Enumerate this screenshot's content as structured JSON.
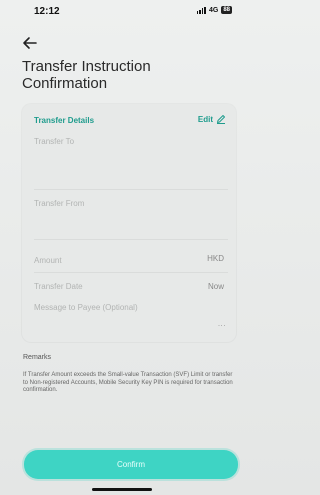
{
  "status_bar": {
    "time": "12:12",
    "network": "4G",
    "battery": "88"
  },
  "header": {
    "title": "Transfer Instruction Confirmation"
  },
  "details": {
    "section_label": "Transfer Details",
    "edit_label": "Edit",
    "transfer_to_label": "Transfer To",
    "transfer_from_label": "Transfer From",
    "amount_label": "Amount",
    "amount_currency": "HKD",
    "date_label": "Transfer Date",
    "date_value": "Now",
    "message_label": "Message to Payee (Optional)",
    "message_value": "..."
  },
  "remarks": {
    "title": "Remarks",
    "body": "If Transfer Amount exceeds the Small-value Transaction (SVF) Limit or transfer to Non-registered Accounts, Mobile Security Key PIN is required for transaction confirmation."
  },
  "actions": {
    "confirm_label": "Confirm"
  },
  "colors": {
    "accent": "#1f9c8d",
    "button": "#3ed4c4"
  }
}
